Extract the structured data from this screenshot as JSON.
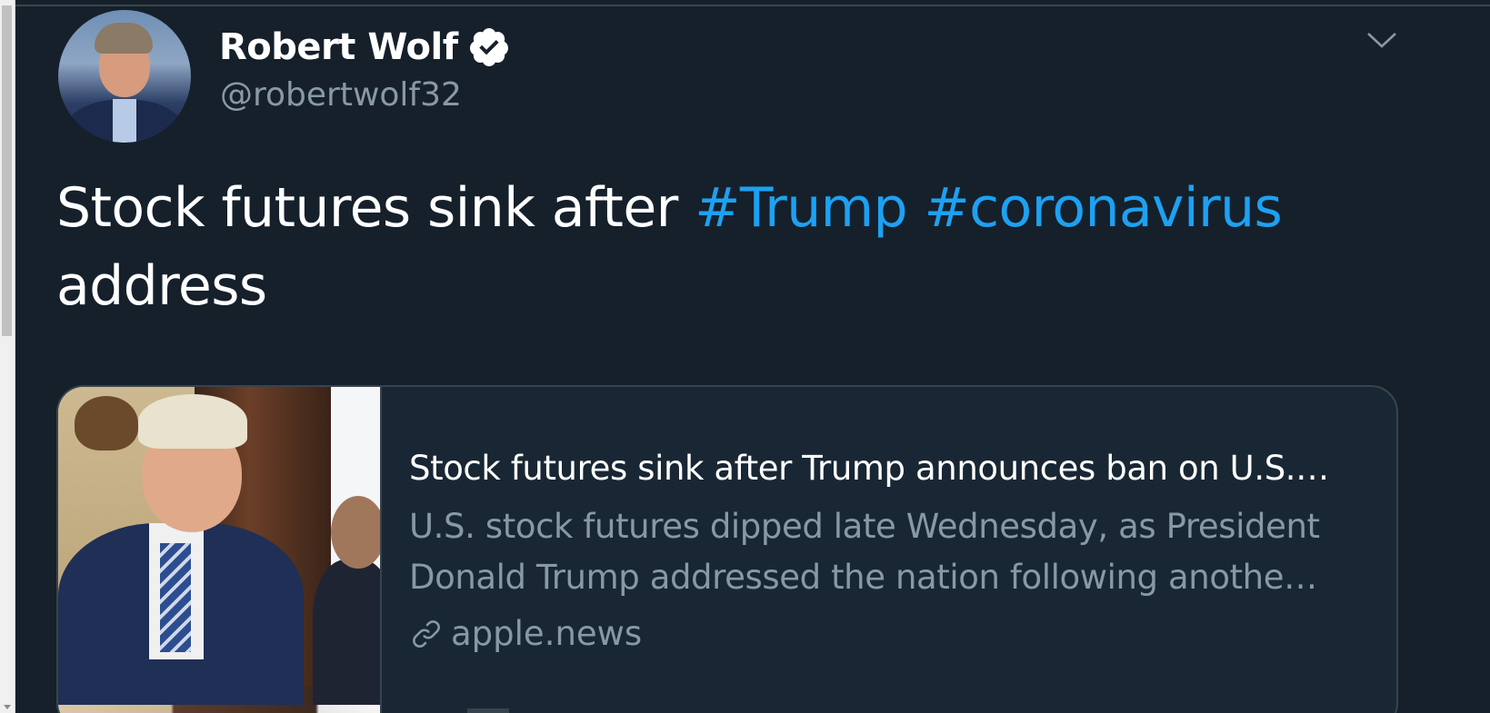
{
  "colors": {
    "background": "#15202b",
    "text_primary": "#ffffff",
    "text_secondary": "#8899a6",
    "accent": "#1da1f2",
    "border": "#38444d"
  },
  "tweet": {
    "author": {
      "display_name": "Robert Wolf",
      "handle": "@robertwolf32",
      "verified_icon": "verified-badge-icon",
      "avatar": "avatar-image"
    },
    "menu_icon": "chevron-down-icon",
    "text": {
      "before": "Stock futures sink after ",
      "hashtag_1": "#Trump",
      "space": " ",
      "hashtag_2": "#coronavirus",
      "after": " address"
    },
    "card": {
      "title": "Stock futures sink after Trump announces ban on U.S.…",
      "description_line_1": "U.S. stock futures dipped late Wednesday, as President",
      "description_line_2": "Donald Trump addressed the nation following anothe…",
      "source_icon": "link-icon",
      "source": "apple.news"
    }
  }
}
